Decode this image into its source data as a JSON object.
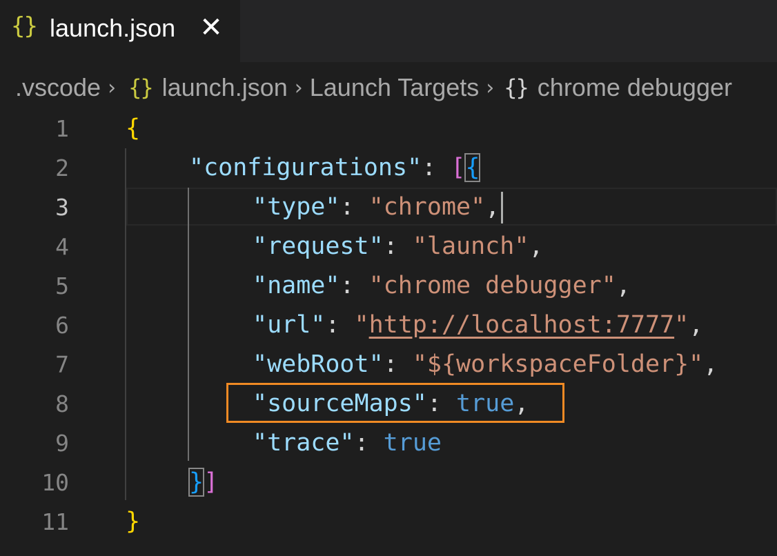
{
  "tab": {
    "icon": "json-braces-icon",
    "icon_glyph": "{}",
    "label": "launch.json",
    "close_glyph": "✕"
  },
  "breadcrumb": {
    "items": [
      ".vscode",
      "launch.json",
      "Launch Targets",
      "chrome debugger"
    ],
    "json_icon_glyph": "{}",
    "object_icon_glyph": "{}",
    "separator": "›"
  },
  "editor": {
    "active_line": 3,
    "line_numbers": [
      "1",
      "2",
      "3",
      "4",
      "5",
      "6",
      "7",
      "8",
      "9",
      "10",
      "11"
    ],
    "lines": {
      "l2_key": "\"configurations\"",
      "l3_key": "\"type\"",
      "l3_val": "\"chrome\"",
      "l4_key": "\"request\"",
      "l4_val": "\"launch\"",
      "l5_key": "\"name\"",
      "l5_val": "\"chrome debugger\"",
      "l6_key": "\"url\"",
      "l6_val": "http://localhost:7777",
      "l7_key": "\"webRoot\"",
      "l7_val": "\"${workspaceFolder}\"",
      "l8_key": "\"sourceMaps\"",
      "l8_val": "true",
      "l9_key": "\"trace\"",
      "l9_val": "true"
    },
    "highlighted_line": 8,
    "colors": {
      "key": "#9cdcfe",
      "string": "#ce9178",
      "boolean": "#569cd6",
      "bracket_level1": "#ffd700",
      "bracket_level2": "#da70d6",
      "bracket_level3": "#179fff",
      "highlight_box": "#f08a24"
    }
  }
}
